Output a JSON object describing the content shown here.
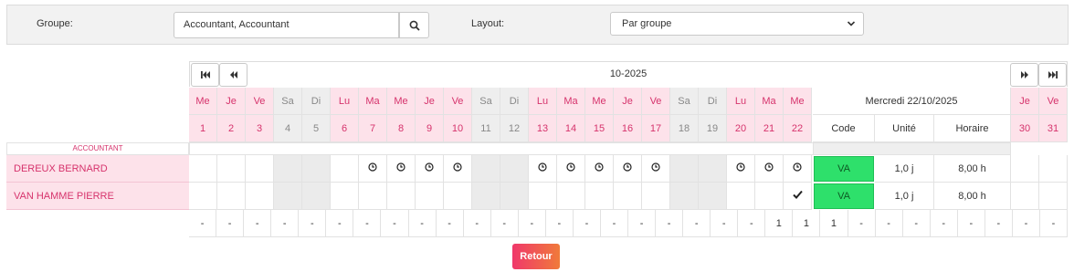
{
  "filters": {
    "group_label": "Groupe:",
    "group_value": "Accountant, Accountant",
    "layout_label": "Layout:",
    "layout_value": "Par groupe"
  },
  "calendar": {
    "month": "10-2025",
    "days": [
      {
        "dow": "Me",
        "num": "1",
        "weekend": false
      },
      {
        "dow": "Je",
        "num": "2",
        "weekend": false
      },
      {
        "dow": "Ve",
        "num": "3",
        "weekend": false
      },
      {
        "dow": "Sa",
        "num": "4",
        "weekend": true
      },
      {
        "dow": "Di",
        "num": "5",
        "weekend": true
      },
      {
        "dow": "Lu",
        "num": "6",
        "weekend": false
      },
      {
        "dow": "Ma",
        "num": "7",
        "weekend": false
      },
      {
        "dow": "Me",
        "num": "8",
        "weekend": false
      },
      {
        "dow": "Je",
        "num": "9",
        "weekend": false
      },
      {
        "dow": "Ve",
        "num": "10",
        "weekend": false
      },
      {
        "dow": "Sa",
        "num": "11",
        "weekend": true
      },
      {
        "dow": "Di",
        "num": "12",
        "weekend": true
      },
      {
        "dow": "Lu",
        "num": "13",
        "weekend": false
      },
      {
        "dow": "Ma",
        "num": "14",
        "weekend": false
      },
      {
        "dow": "Me",
        "num": "15",
        "weekend": false
      },
      {
        "dow": "Je",
        "num": "16",
        "weekend": false
      },
      {
        "dow": "Ve",
        "num": "17",
        "weekend": false
      },
      {
        "dow": "Sa",
        "num": "18",
        "weekend": true
      },
      {
        "dow": "Di",
        "num": "19",
        "weekend": true
      },
      {
        "dow": "Lu",
        "num": "20",
        "weekend": false
      },
      {
        "dow": "Ma",
        "num": "21",
        "weekend": false
      },
      {
        "dow": "Me",
        "num": "22",
        "weekend": false
      }
    ],
    "selected_day_title": "Mercredi 22/10/2025",
    "detail_headers": [
      "Code",
      "Unité",
      "Horaire"
    ],
    "tail_days": [
      {
        "dow": "Je",
        "num": "30"
      },
      {
        "dow": "Ve",
        "num": "31"
      }
    ],
    "group_name": "ACCOUNTANT",
    "employees": [
      {
        "name": "DEREUX BERNARD",
        "marks": [
          "",
          "",
          "",
          "",
          "",
          "",
          "clock",
          "clock",
          "clock",
          "clock",
          "",
          "",
          "clock",
          "clock",
          "clock",
          "clock",
          "clock",
          "",
          "",
          "clock",
          "clock",
          "clock"
        ],
        "code": "VA",
        "unit": "1,0 j",
        "schedule": "8,00 h"
      },
      {
        "name": "VAN HAMME PIERRE",
        "marks": [
          "",
          "",
          "",
          "",
          "",
          "",
          "",
          "",
          "",
          "",
          "",
          "",
          "",
          "",
          "",
          "",
          "",
          "",
          "",
          "",
          "",
          "check"
        ],
        "code": "VA",
        "unit": "1,0 j",
        "schedule": "8,00 h"
      }
    ],
    "totals": [
      "-",
      "-",
      "-",
      "-",
      "-",
      "-",
      "-",
      "-",
      "-",
      "-",
      "-",
      "-",
      "-",
      "-",
      "-",
      "-",
      "-",
      "-",
      "-",
      "-",
      "-",
      "1",
      "1",
      "1",
      "-",
      "-",
      "-",
      "-",
      "-",
      "-",
      "-",
      "-"
    ]
  },
  "actions": {
    "back_label": "Retour"
  },
  "colors": {
    "accent_pink": "#d6336c",
    "weekday_header_bg": "#fde2ea",
    "weekend_bg": "#eeeeee",
    "va_green": "#2ee06b",
    "retour_gradient_start": "#f0386b",
    "retour_gradient_end": "#f07a3a"
  }
}
